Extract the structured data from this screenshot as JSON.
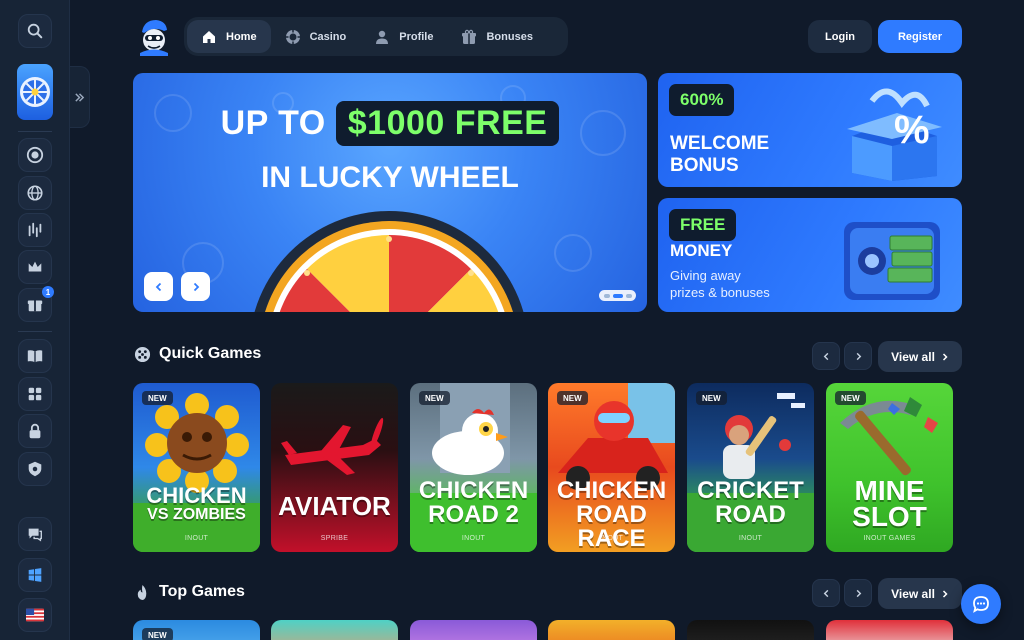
{
  "header": {
    "nav": [
      {
        "label": "Home",
        "icon": "home-icon",
        "active": true
      },
      {
        "label": "Casino",
        "icon": "casino-chip-icon",
        "active": false
      },
      {
        "label": "Profile",
        "icon": "profile-icon",
        "active": false
      },
      {
        "label": "Bonuses",
        "icon": "gift-icon",
        "active": false
      }
    ],
    "login_label": "Login",
    "register_label": "Register"
  },
  "sidebar": {
    "items": [
      {
        "icon": "search-icon"
      },
      {
        "icon": "lucky-wheel-icon"
      },
      {
        "icon": "casino-chip-icon"
      },
      {
        "icon": "globe-icon"
      },
      {
        "icon": "stats-icon"
      },
      {
        "icon": "crown-icon"
      },
      {
        "icon": "gift-icon",
        "badge": "1"
      },
      {
        "icon": "book-icon"
      },
      {
        "icon": "games-icon"
      },
      {
        "icon": "lock-icon"
      },
      {
        "icon": "shield-icon"
      },
      {
        "icon": "support-chat-icon"
      },
      {
        "icon": "windows-icon"
      },
      {
        "icon": "us-flag-icon"
      }
    ]
  },
  "hero": {
    "line1_prefix": "UP TO",
    "line1_highlight": "$1000 FREE",
    "line2": "IN LUCKY WHEEL"
  },
  "promos": [
    {
      "tag": "600%",
      "title_1": "WELCOME",
      "title_2": "BONUS"
    },
    {
      "tag": "FREE",
      "title_1": "MONEY",
      "subtitle_1": "Giving away",
      "subtitle_2": "prizes & bonuses"
    }
  ],
  "quick_games": {
    "title": "Quick Games",
    "view_all": "View all",
    "games": [
      {
        "name_1": "CHICKEN",
        "name_2": "VS ZOMBIES",
        "provider": "INOUT",
        "new": true
      },
      {
        "name_1": "AVIATOR",
        "name_2": "",
        "provider": "SPRIBE",
        "new": false
      },
      {
        "name_1": "CHICKEN",
        "name_2": "ROAD 2",
        "provider": "INOUT",
        "new": true
      },
      {
        "name_1": "CHICKEN",
        "name_2": "ROAD RACE",
        "provider": "INOUT",
        "new": true
      },
      {
        "name_1": "CRICKET",
        "name_2": "ROAD",
        "provider": "INOUT",
        "new": true
      },
      {
        "name_1": "MINE",
        "name_2": "SLOT",
        "provider": "INOUT GAMES",
        "new": true
      }
    ],
    "new_label": "NEW"
  },
  "top_games": {
    "title": "Top Games",
    "view_all": "View all",
    "new_label": "NEW"
  },
  "colors": {
    "background": "#101a2a",
    "accent": "#2f7bff",
    "highlight_green": "#7dff6a"
  }
}
